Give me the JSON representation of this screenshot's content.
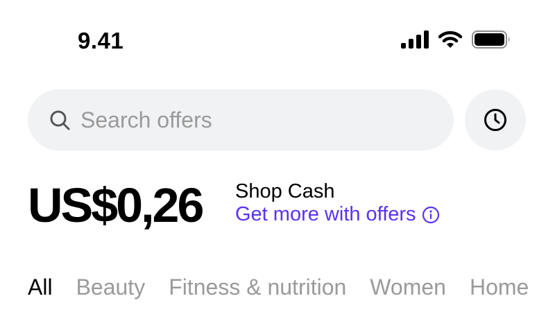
{
  "status_bar": {
    "time": "9.41",
    "icons": [
      "signal-icon",
      "wifi-icon",
      "battery-icon"
    ]
  },
  "search": {
    "placeholder": "Search offers",
    "history_button_icon": "clock-icon"
  },
  "shop_cash": {
    "amount": "US$0,26",
    "label": "Shop Cash",
    "link_text": "Get more with offers",
    "link_icon": "info-icon"
  },
  "categories": [
    {
      "label": "All",
      "active": true
    },
    {
      "label": "Beauty",
      "active": false
    },
    {
      "label": "Fitness & nutrition",
      "active": false
    },
    {
      "label": "Women",
      "active": false
    },
    {
      "label": "Home",
      "active": false
    }
  ],
  "colors": {
    "accent": "#5a31f4",
    "search_background": "#f1f2f4",
    "muted_text": "#9a9a9a"
  }
}
